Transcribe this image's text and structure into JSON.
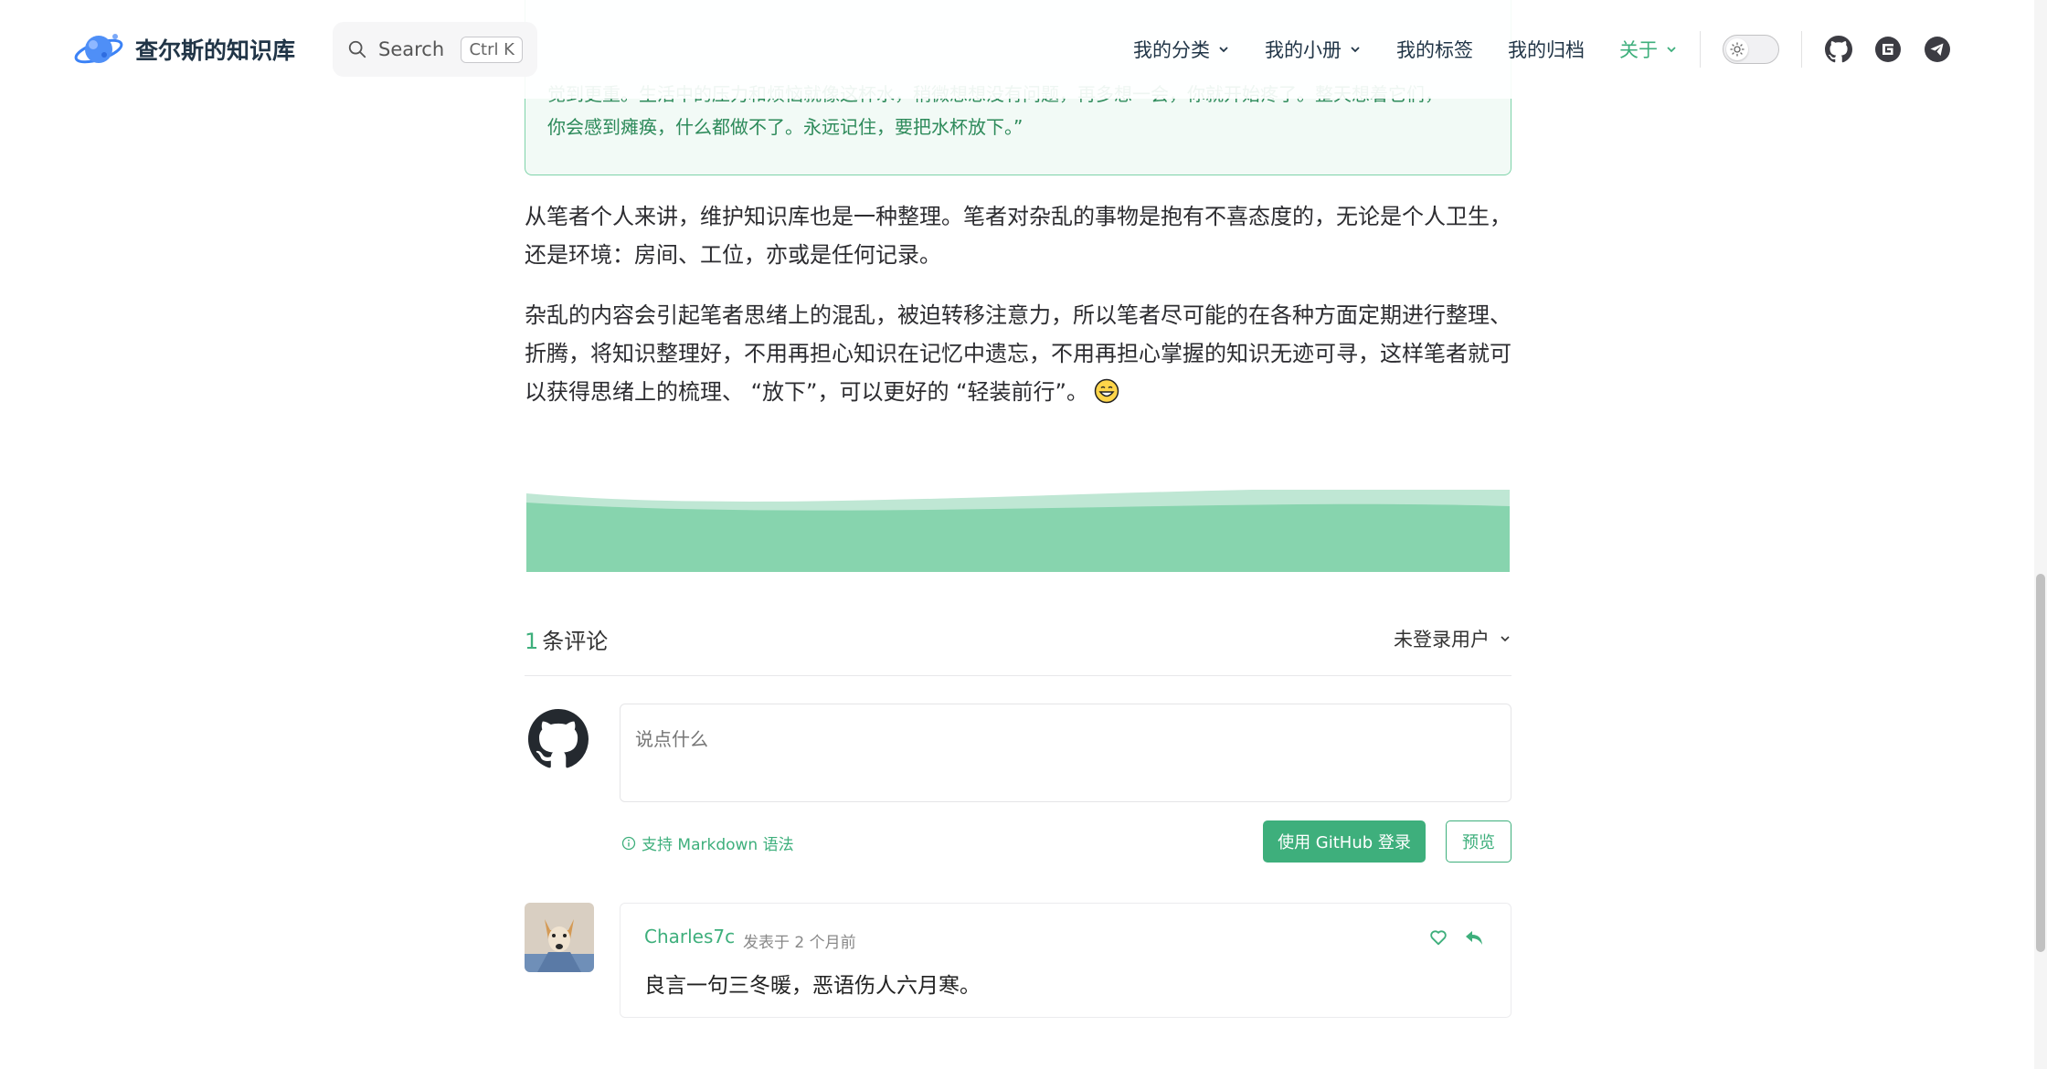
{
  "navbar": {
    "brand": "查尔斯的知识库",
    "search_placeholder": "Search",
    "search_shortcut": "Ctrl K",
    "items": [
      {
        "label": "我的分类",
        "has_dropdown": true
      },
      {
        "label": "我的小册",
        "has_dropdown": true
      },
      {
        "label": "我的标签",
        "has_dropdown": false
      },
      {
        "label": "我的归档",
        "has_dropdown": false
      },
      {
        "label": "关于",
        "has_dropdown": true
      }
    ],
    "social_icons": [
      "github-icon",
      "gitee-icon",
      "telegram-icon"
    ],
    "accent_color": "#3eaf7c"
  },
  "quote": {
    "line1": "觉到更重。生活中的压力和烦恼就像这杯水，稍微想想没有问题，再多想一会，你就开始疼了。整天想着它们，",
    "line2": "你会感到瘫痪，什么都做不了。永远记住，要把水杯放下。”"
  },
  "article": {
    "para1_line1": "从笔者个人来讲，维护知识库也是一种整理。笔者对杂乱的事物是抱有不喜态度的，无论是个人卫生，",
    "para1_line2": "还是环境：房间、工位，亦或是任何记录。",
    "para2_line1": "杂乱的内容会引起笔者思绪上的混乱，被迫转移注意力，所以笔者尽可能的在各种方面定期进行整理、",
    "para2_line2": "折腾，将知识整理好，不用再担心知识在记忆中遗忘，不用再担心掌握的知识无迹可寻，这样笔者就可",
    "para2_line3": "以获得思绪上的梳理、 “放下”，可以更好的 “轻装前行”。"
  },
  "comments": {
    "count": "1",
    "count_label": "条评论",
    "user_status": "未登录用户",
    "placeholder": "说点什么",
    "markdown_hint": "支持 Markdown 语法",
    "login_button": "使用 GitHub 登录",
    "preview_button": "预览",
    "list": [
      {
        "author": "Charles7c",
        "meta": "发表于  2 个月前",
        "body": "良言一句三冬暖，恶语伤人六月寒。"
      }
    ]
  }
}
